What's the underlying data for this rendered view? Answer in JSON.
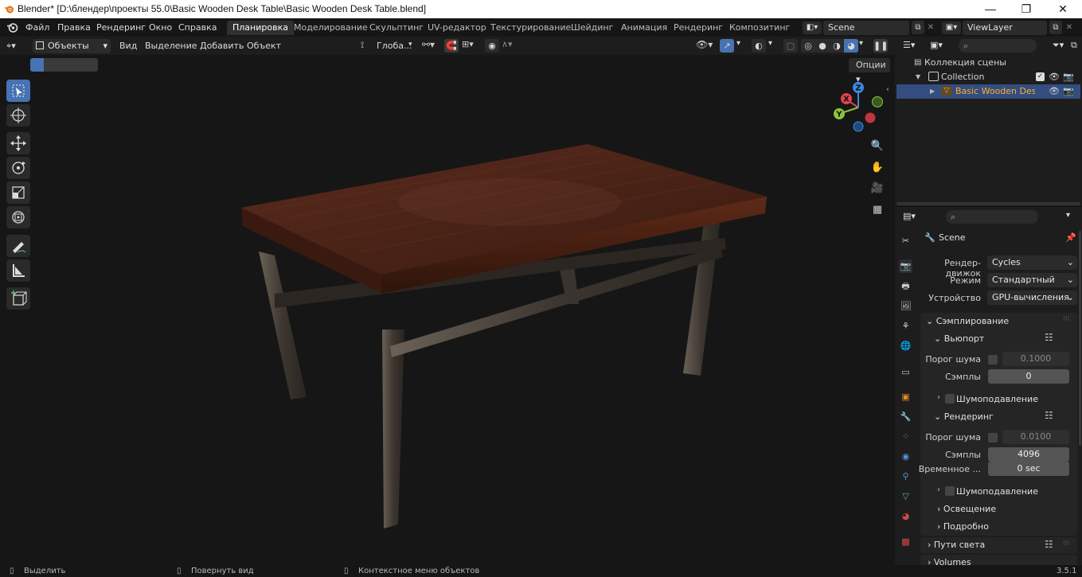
{
  "window": {
    "title": "Blender* [D:\\блендер\\проекты 55.0\\Basic Wooden Desk Table\\Basic Wooden Desk Table.blend]",
    "minimize": "—",
    "maximize": "❐",
    "close": "✕"
  },
  "menu": [
    "Файл",
    "Правка",
    "Рендеринг",
    "Окно",
    "Справка"
  ],
  "workspaces": [
    "Планировка",
    "Моделирование",
    "Скульптинг",
    "UV-редактор",
    "Текстурирование",
    "Шейдинг",
    "Анимация",
    "Рендеринг",
    "Композитинг"
  ],
  "active_workspace": "Планировка",
  "scene_name": "Scene",
  "view_layer": "ViewLayer",
  "viewport_header": {
    "mode": "Объекты",
    "menus": [
      "Вид",
      "Выделение",
      "Добавить",
      "Объект"
    ],
    "transform_orientation": "Глоба...",
    "options": "Опции"
  },
  "gizmo": {
    "x": "X",
    "y": "Y",
    "z": "Z"
  },
  "outliner": {
    "scene_collection": "Коллекция сцены",
    "collection": "Collection",
    "object": "Basic Wooden Desk T"
  },
  "properties": {
    "context": "Scene",
    "engine_label": "Рендер-движок",
    "engine_value": "Cycles",
    "mode_label": "Режим",
    "mode_value": "Стандартный",
    "device_label": "Устройство",
    "device_value": "GPU-вычисления",
    "sampling": "Сэмплирование",
    "viewport": "Вьюпорт",
    "noise_threshold_label": "Порог шума",
    "viewport_noise": "0.1000",
    "samples_label": "Сэмплы",
    "viewport_samples": "0",
    "denoise": "Шумоподавление",
    "render": "Рендеринг",
    "render_noise": "0.0100",
    "render_samples": "4096",
    "time_label": "Временное ...",
    "time_value": "0 sec",
    "denoise2": "Шумоподавление",
    "lighting": "Освещение",
    "advanced": "Подробно",
    "light_paths": "Пути света",
    "volumes": "Volumes"
  },
  "status": {
    "select": "Выделить",
    "rotate": "Повернуть вид",
    "context_menu": "Контекстное меню объектов",
    "version": "3.5.1"
  },
  "colors": {
    "accent": "#4772b3",
    "active_object": "#ffaf29",
    "x_axis": "#e2434c",
    "y_axis": "#8ac53b",
    "z_axis": "#3b8ae2"
  }
}
